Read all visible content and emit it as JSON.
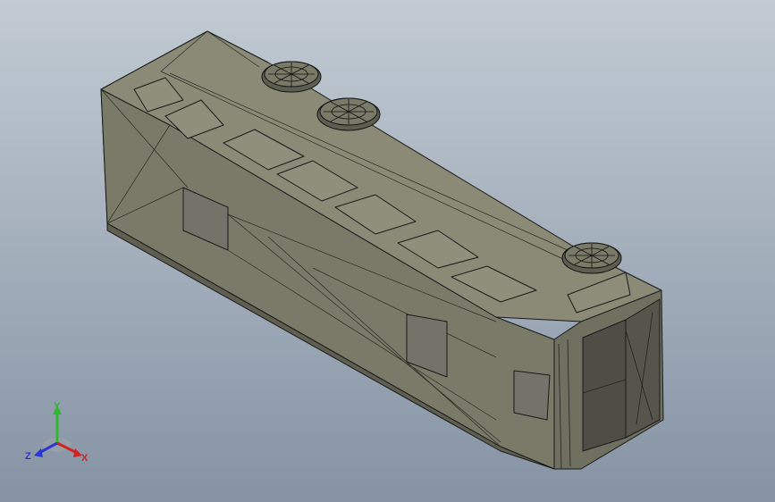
{
  "viewport": {
    "background_top": "#b9c3cc",
    "background_bottom": "#8a98a8"
  },
  "model": {
    "name": "bus",
    "body_color": "#7b7b6a",
    "top_color": "#8a8a78",
    "front_color": "#6f6f60",
    "edge_color": "#1a1a1a",
    "window_color": "#55554b",
    "fan_count": 3
  },
  "triad": {
    "x_label": "X",
    "y_label": "Y",
    "z_label": "Z",
    "x_color": "#d22323",
    "y_color": "#2eb82e",
    "z_color": "#2a37d6"
  }
}
